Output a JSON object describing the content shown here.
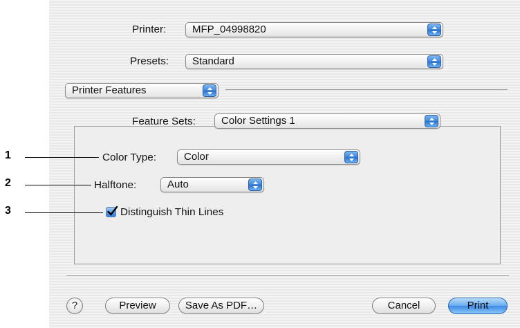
{
  "printer": {
    "label": "Printer:",
    "value": "MFP_04998820"
  },
  "presets": {
    "label": "Presets:",
    "value": "Standard"
  },
  "panel_select": {
    "value": "Printer Features"
  },
  "feature_sets": {
    "label": "Feature Sets:",
    "value": "Color Settings 1"
  },
  "color_type": {
    "label": "Color Type:",
    "value": "Color"
  },
  "halftone": {
    "label": "Halftone:",
    "value": "Auto"
  },
  "thin_lines": {
    "label": "Distinguish Thin Lines",
    "checked": true
  },
  "callouts": [
    "1",
    "2",
    "3"
  ],
  "buttons": {
    "help": "?",
    "preview": "Preview",
    "save_pdf": "Save As PDF…",
    "cancel": "Cancel",
    "print": "Print"
  }
}
